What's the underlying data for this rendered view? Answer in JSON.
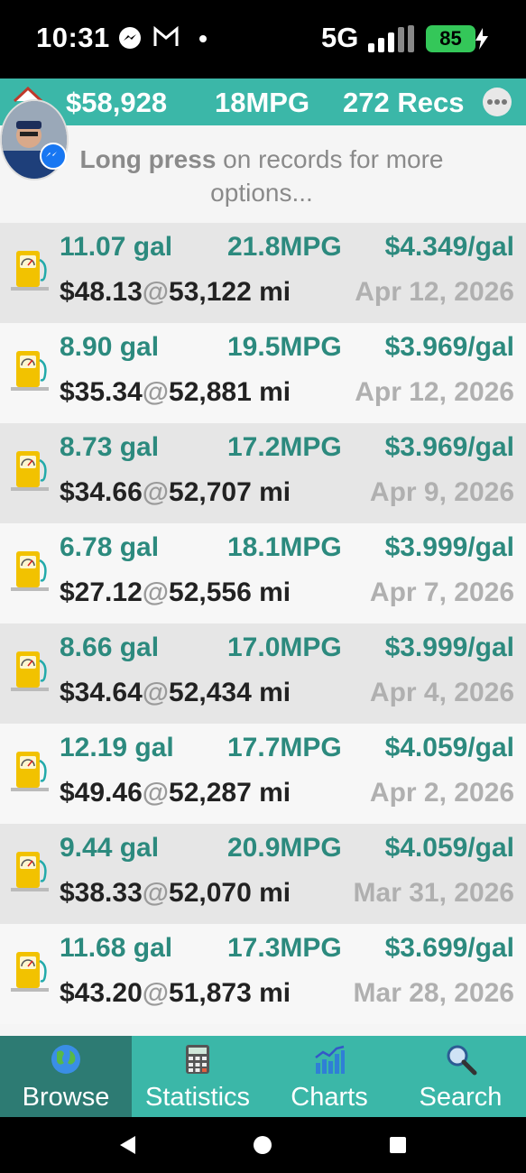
{
  "status_bar": {
    "time": "10:31",
    "network": "5G",
    "battery": "85",
    "icons": [
      "messenger-icon",
      "gmail-icon",
      "dot-icon",
      "signal-icon",
      "battery-charging-icon"
    ]
  },
  "header": {
    "total_cost": "$58,928",
    "avg_mpg": "18MPG",
    "record_count": "272 Recs",
    "icons": [
      "home-icon",
      "more-options-icon"
    ]
  },
  "hint": {
    "bold": "Long press",
    "rest": " on records for more options..."
  },
  "records": [
    {
      "gallons": "11.07 gal",
      "mpg": "21.8MPG",
      "price": "$4.349/gal",
      "cost": "$48.13",
      "at": "@",
      "odometer": "53,122 mi",
      "date": "Apr 12, 2026"
    },
    {
      "gallons": "8.90 gal",
      "mpg": "19.5MPG",
      "price": "$3.969/gal",
      "cost": "$35.34",
      "at": "@",
      "odometer": "52,881 mi",
      "date": "Apr 12, 2026"
    },
    {
      "gallons": "8.73 gal",
      "mpg": "17.2MPG",
      "price": "$3.969/gal",
      "cost": "$34.66",
      "at": "@",
      "odometer": "52,707 mi",
      "date": "Apr 9, 2026"
    },
    {
      "gallons": "6.78 gal",
      "mpg": "18.1MPG",
      "price": "$3.999/gal",
      "cost": "$27.12",
      "at": "@",
      "odometer": "52,556 mi",
      "date": "Apr 7, 2026"
    },
    {
      "gallons": "8.66 gal",
      "mpg": "17.0MPG",
      "price": "$3.999/gal",
      "cost": "$34.64",
      "at": "@",
      "odometer": "52,434 mi",
      "date": "Apr 4, 2026"
    },
    {
      "gallons": "12.19 gal",
      "mpg": "17.7MPG",
      "price": "$4.059/gal",
      "cost": "$49.46",
      "at": "@",
      "odometer": "52,287 mi",
      "date": "Apr 2, 2026"
    },
    {
      "gallons": "9.44 gal",
      "mpg": "20.9MPG",
      "price": "$4.059/gal",
      "cost": "$38.33",
      "at": "@",
      "odometer": "52,070 mi",
      "date": "Mar 31, 2026"
    },
    {
      "gallons": "11.68 gal",
      "mpg": "17.3MPG",
      "price": "$3.699/gal",
      "cost": "$43.20",
      "at": "@",
      "odometer": "51,873 mi",
      "date": "Mar 28, 2026"
    }
  ],
  "bottom_nav": {
    "tabs": [
      {
        "label": "Browse",
        "icon": "globe-icon",
        "active": true
      },
      {
        "label": "Statistics",
        "icon": "calculator-icon",
        "active": false
      },
      {
        "label": "Charts",
        "icon": "chart-icon",
        "active": false
      },
      {
        "label": "Search",
        "icon": "magnifier-icon",
        "active": false
      }
    ]
  },
  "colors": {
    "accent": "#3bb7a8",
    "accent_dark": "#2d7b73",
    "value_text": "#2c8a7e",
    "row_alt": "#e6e6e6"
  }
}
